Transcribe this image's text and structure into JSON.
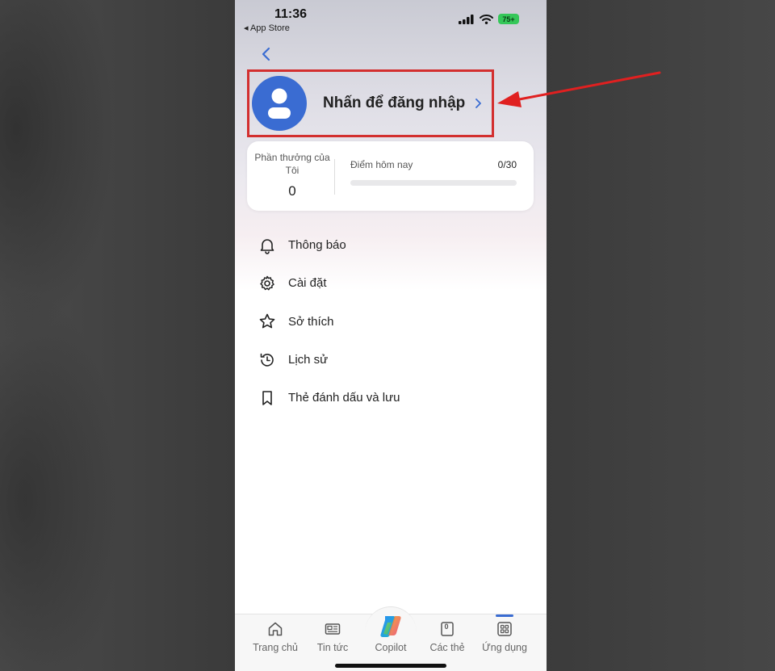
{
  "status_bar": {
    "time": "11:36",
    "back_app": "◂ App Store",
    "battery": "75+"
  },
  "profile": {
    "login_label": "Nhấn để đăng nhập"
  },
  "rewards": {
    "my_rewards_label": "Phần thưởng của Tôi",
    "my_rewards_count": "0",
    "today_points_label": "Điểm hôm nay",
    "today_points_value": "0/30",
    "progress_fraction": 0
  },
  "menu": {
    "items": [
      {
        "label": "Thông báo",
        "icon": "bell-icon"
      },
      {
        "label": "Cài đặt",
        "icon": "gear-icon"
      },
      {
        "label": "Sở thích",
        "icon": "star-icon"
      },
      {
        "label": "Lịch sử",
        "icon": "history-icon"
      },
      {
        "label": "Thẻ đánh dấu và lưu",
        "icon": "bookmark-icon"
      }
    ]
  },
  "bottom_nav": {
    "items": [
      {
        "label": "Trang chủ",
        "icon": "home-icon"
      },
      {
        "label": "Tin tức",
        "icon": "news-icon"
      },
      {
        "label": "Copilot",
        "icon": "copilot-icon"
      },
      {
        "label": "Các thẻ",
        "icon": "tabs-icon",
        "tab_count": "0"
      },
      {
        "label": "Ứng dụng",
        "icon": "apps-icon",
        "active": true
      }
    ]
  },
  "colors": {
    "accent": "#3a6cd2",
    "highlight": "#d32f2f"
  }
}
